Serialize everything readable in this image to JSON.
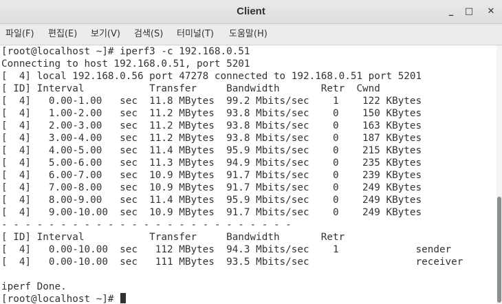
{
  "window": {
    "title": "Client",
    "controls": {
      "minimize": "_",
      "maximize": "□",
      "close": "✕"
    }
  },
  "menu": [
    "파일(F)",
    "편집(E)",
    "보기(V)",
    "검색(S)",
    "터미널(T)",
    "도움말(H)"
  ],
  "terminal": {
    "lines": [
      "[root@localhost ~]# iperf3 -c 192.168.0.51",
      "Connecting to host 192.168.0.51, port 5201",
      "[  4] local 192.168.0.56 port 47278 connected to 192.168.0.51 port 5201",
      "[ ID] Interval           Transfer     Bandwidth       Retr  Cwnd",
      "[  4]   0.00-1.00   sec  11.8 MBytes  99.2 Mbits/sec    1    122 KBytes",
      "[  4]   1.00-2.00   sec  11.2 MBytes  93.8 Mbits/sec    0    150 KBytes",
      "[  4]   2.00-3.00   sec  11.2 MBytes  93.8 Mbits/sec    0    163 KBytes",
      "[  4]   3.00-4.00   sec  11.2 MBytes  93.8 Mbits/sec    0    187 KBytes",
      "[  4]   4.00-5.00   sec  11.4 MBytes  95.9 Mbits/sec    0    215 KBytes",
      "[  4]   5.00-6.00   sec  11.3 MBytes  94.9 Mbits/sec    0    235 KBytes",
      "[  4]   6.00-7.00   sec  10.9 MBytes  91.7 Mbits/sec    0    239 KBytes",
      "[  4]   7.00-8.00   sec  10.9 MBytes  91.7 Mbits/sec    0    249 KBytes",
      "[  4]   8.00-9.00   sec  11.4 MBytes  95.9 Mbits/sec    0    249 KBytes",
      "[  4]   9.00-10.00  sec  10.9 MBytes  91.7 Mbits/sec    0    249 KBytes",
      "- - - - - - - - - - - - - - - - - - - - - - - - -",
      "[ ID] Interval           Transfer     Bandwidth       Retr",
      "[  4]   0.00-10.00  sec   112 MBytes  94.3 Mbits/sec    1             sender",
      "[  4]   0.00-10.00  sec   111 MBytes  93.5 Mbits/sec                  receiver",
      "",
      "iperf Done.",
      "[root@localhost ~]# "
    ]
  }
}
